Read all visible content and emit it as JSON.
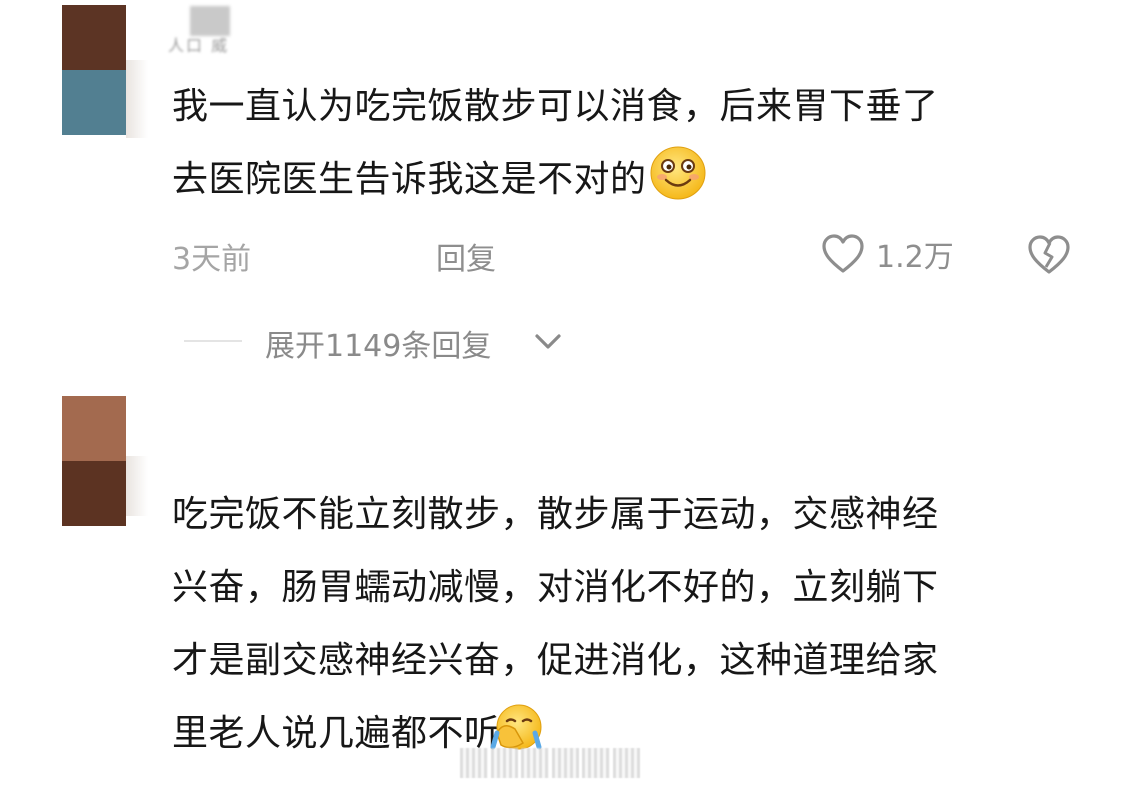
{
  "comments": [
    {
      "username": "人口 威",
      "text_line1": "我一直认为吃完饭散步可以消食，后来胃下垂了",
      "text_line2": "去医院医生告诉我这是不对的",
      "emoji": "smiling-face-emoji",
      "time": "3天前",
      "reply_label": "回复",
      "likes": "1.2万",
      "expand_label": "展开1149条回复",
      "avatar_colors": [
        "#5c3424",
        "#527f91"
      ]
    },
    {
      "text_line1": "吃完饭不能立刻散步，散步属于运动，交感神经",
      "text_line2": "兴奋，肠胃蠕动减慢，对消化不好的，立刻躺下",
      "text_line3": "才是副交感神经兴奋，促进消化，这种道理给家",
      "text_line4": "里老人说几遍都不听",
      "emoji": "facepalm-emoji",
      "avatar_colors": [
        "#a36a4f",
        "#5c3322"
      ]
    }
  ],
  "colors": {
    "text": "#171717",
    "meta": "#a5a5a5",
    "icon": "#8e8e8e",
    "emoji": "#ffd233"
  }
}
